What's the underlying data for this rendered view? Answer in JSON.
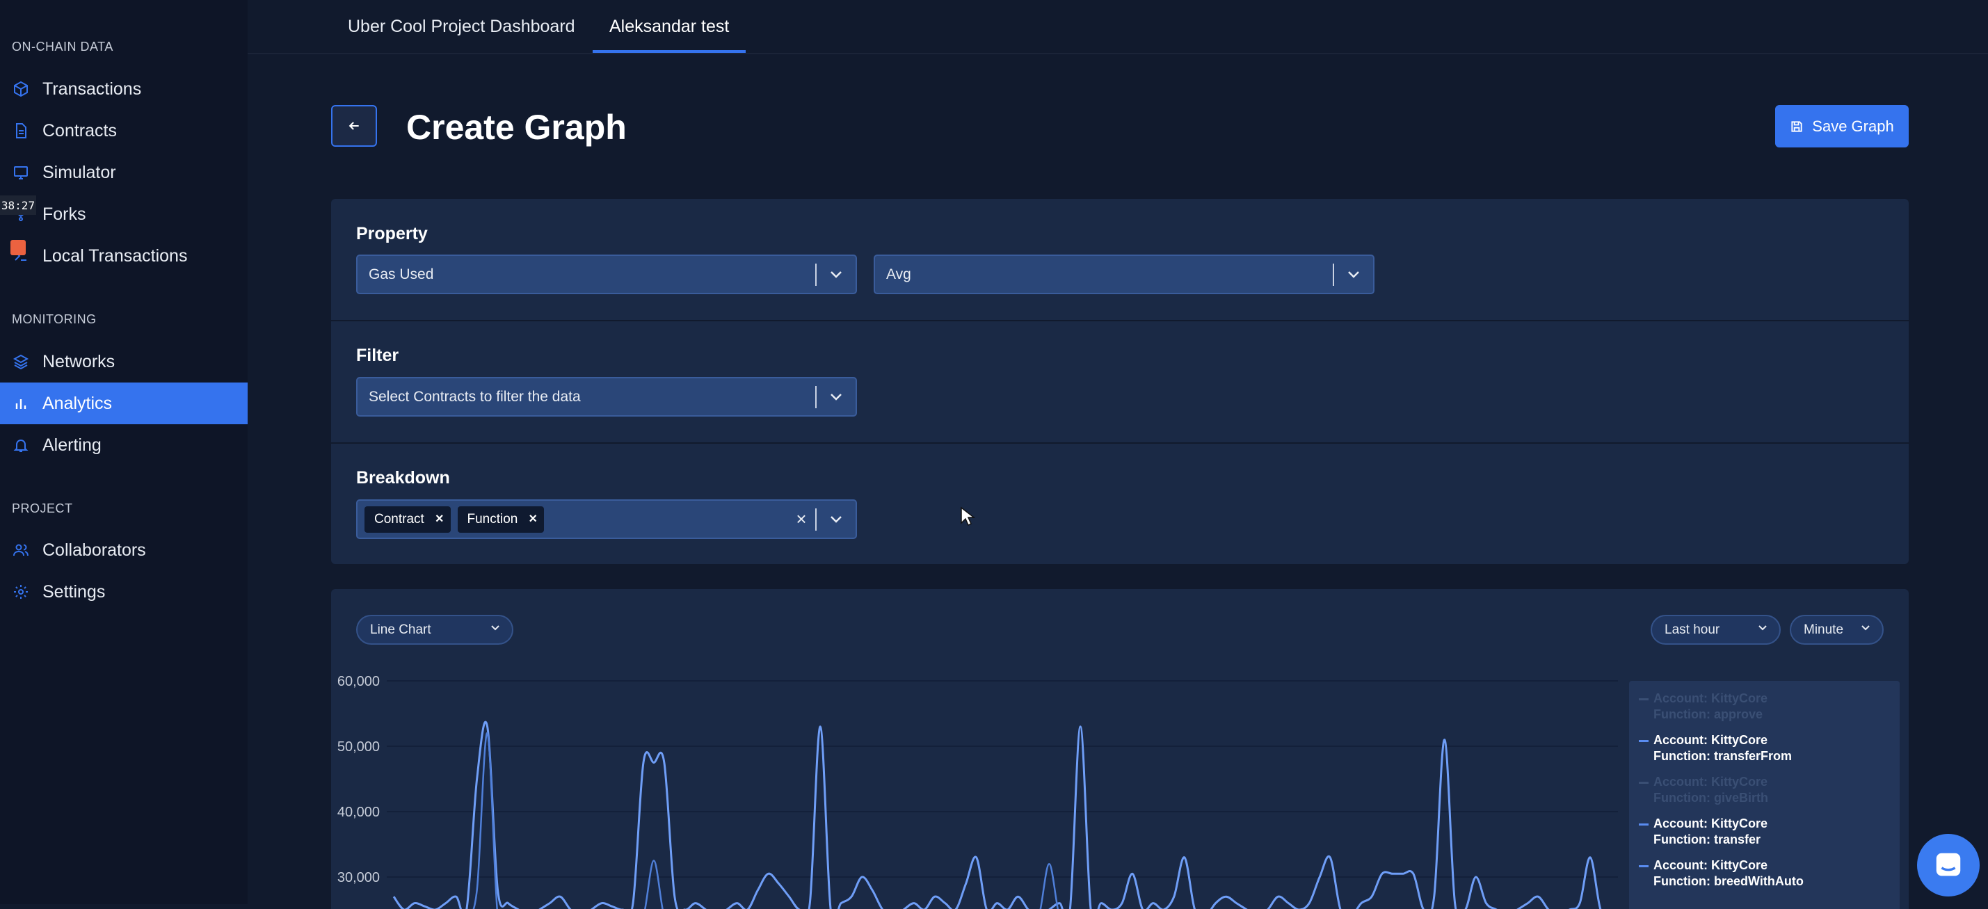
{
  "sidebar": {
    "sections": {
      "onchain": "ON-CHAIN DATA",
      "monitoring": "MONITORING",
      "project": "PROJECT"
    },
    "items": {
      "transactions": "Transactions",
      "contracts": "Contracts",
      "simulator": "Simulator",
      "forks": "Forks",
      "local_transactions": "Local Transactions",
      "networks": "Networks",
      "analytics": "Analytics",
      "alerting": "Alerting",
      "collaborators": "Collaborators",
      "settings": "Settings"
    },
    "active_item": "analytics",
    "overlay_timer": "38:27"
  },
  "tabs": {
    "items": [
      "Uber Cool Project Dashboard",
      "Aleksandar test"
    ],
    "active_index": 1
  },
  "header": {
    "title": "Create Graph",
    "save_label": "Save Graph"
  },
  "property": {
    "label": "Property",
    "metric_value": "Gas Used",
    "aggregation_value": "Avg"
  },
  "filter": {
    "label": "Filter",
    "placeholder": "Select Contracts to filter the data"
  },
  "breakdown": {
    "label": "Breakdown",
    "chips": [
      "Contract",
      "Function"
    ]
  },
  "chart_controls": {
    "chart_type": "Line Chart",
    "range": "Last hour",
    "interval": "Minute"
  },
  "legend": {
    "account_prefix": "Account:",
    "function_prefix": "Function:",
    "entries": [
      {
        "account": "KittyCore",
        "function": "approve",
        "active": false
      },
      {
        "account": "KittyCore",
        "function": "transferFrom",
        "active": true
      },
      {
        "account": "KittyCore",
        "function": "giveBirth",
        "active": false
      },
      {
        "account": "KittyCore",
        "function": "transfer",
        "active": true
      },
      {
        "account": "KittyCore",
        "function": "breedWithAuto",
        "active": true
      }
    ]
  },
  "colors": {
    "accent": "#3573ee",
    "line": "#6f9ef7",
    "background": "#111a2d",
    "panel": "#1a2945"
  },
  "chart_data": {
    "type": "line",
    "ylim": [
      20000,
      60000
    ],
    "yticks": [
      60000,
      50000,
      40000,
      30000
    ],
    "ytick_labels": [
      "60,000",
      "50,000",
      "40,000",
      "30,000"
    ],
    "series": [
      {
        "name": "Account: KittyCore Function: transferFrom",
        "values": [
          27000,
          25000,
          26000,
          25500,
          25000,
          26000,
          27000,
          25000,
          45000,
          53000,
          28000,
          26000,
          25000,
          24000,
          25000,
          26000,
          27000,
          25000,
          24000,
          25000,
          26000,
          25500,
          25000,
          26000,
          47500,
          47500,
          47500,
          27000,
          25000,
          26000,
          25000,
          24000,
          25000,
          26000,
          25000,
          28000,
          30500,
          29000,
          27000,
          25000,
          26000,
          53000,
          25000,
          26000,
          27000,
          30000,
          28000,
          25000,
          24000,
          25000,
          26000,
          25000,
          27000,
          26000,
          25000,
          29000,
          33000,
          25000,
          26000,
          25000,
          27000,
          25000,
          24000,
          25000,
          26000,
          25000,
          53000,
          25000,
          26000,
          25000,
          26000,
          30500,
          25000,
          26000,
          25000,
          27000,
          33000,
          25000,
          24000,
          26000,
          27000,
          26000,
          25000,
          24000,
          25000,
          27000,
          26000,
          25000,
          26000,
          30000,
          33000,
          25000,
          24000,
          26000,
          27000,
          30500,
          30500,
          30500,
          30500,
          25000,
          27000,
          51000,
          26000,
          25000,
          30000,
          26000,
          25000,
          24000,
          25000,
          26000,
          27000,
          25000,
          24000,
          25000,
          26000,
          33000,
          25000,
          24000
        ]
      },
      {
        "name": "Account: KittyCore Function: transfer",
        "values": [
          24000,
          24000,
          24000,
          24000,
          24000,
          24000,
          24000,
          24000,
          28000,
          52000,
          24000,
          24000,
          24000,
          24000,
          24000,
          24000,
          24000,
          24000,
          24000,
          24000,
          24000,
          24000,
          24000,
          24000,
          24000,
          32500,
          24000,
          24000,
          24000,
          24000,
          24000,
          24000,
          24000,
          24000,
          24000,
          24000,
          24000,
          24000,
          24000,
          24000,
          24000,
          24000,
          24000,
          24000,
          24000,
          24000,
          24000,
          24000,
          24000,
          24000,
          24000,
          24000,
          24000,
          24000,
          24000,
          24000,
          24000,
          24000,
          24000,
          24000,
          24000,
          24000,
          24000,
          32000,
          24000,
          24000,
          24000,
          24000,
          24000,
          24000,
          24000,
          24000,
          24000,
          24000,
          24000,
          24000,
          24000,
          24000,
          24000,
          24000,
          24000,
          24000,
          24000,
          24000,
          24000,
          24000,
          24000,
          24000,
          24000,
          24000,
          24000,
          24000,
          24000,
          24000,
          24000,
          24000,
          24000,
          24000,
          24000,
          24000,
          24000,
          24000,
          24000,
          24000,
          24000,
          24000,
          24000,
          24000,
          24000,
          24000,
          24000,
          24000,
          24000,
          24000,
          24000,
          24000,
          24000,
          24000
        ]
      }
    ]
  }
}
